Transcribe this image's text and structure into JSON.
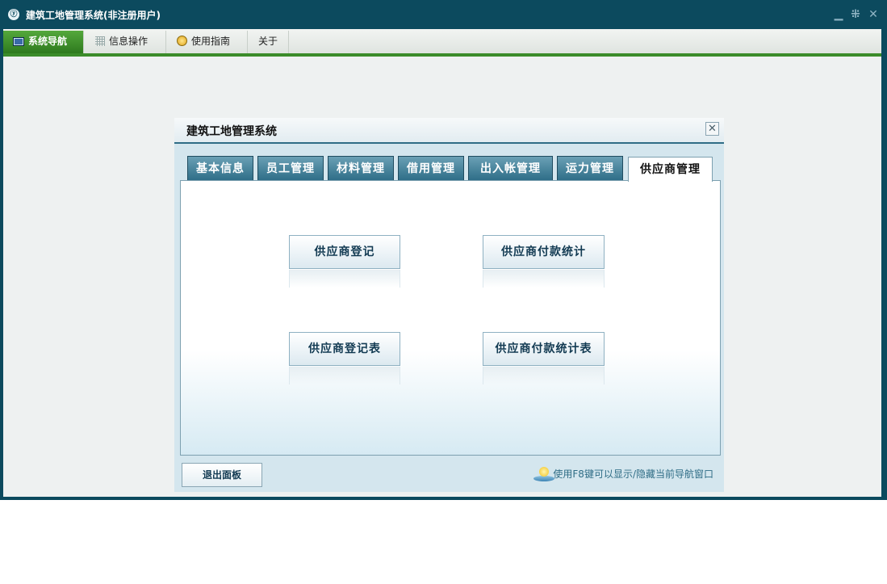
{
  "window": {
    "title": "建筑工地管理系统(非注册用户)",
    "logo_text": "ⓨ",
    "controls": {
      "minimize": "▁",
      "restore": "⁜",
      "close": "✕"
    }
  },
  "menubar": {
    "tabs": [
      {
        "label": "系统导航",
        "icon": "monitor-icon",
        "active": true
      },
      {
        "label": "信息操作",
        "icon": "grid-icon",
        "active": false
      },
      {
        "label": "使用指南",
        "icon": "bulb-icon",
        "active": false
      },
      {
        "label": "关于",
        "icon": "",
        "active": false
      }
    ]
  },
  "panel": {
    "title": "建筑工地管理系统",
    "close_label": "✕",
    "tabs": [
      "基本信息",
      "员工管理",
      "材料管理",
      "借用管理",
      "出入帐管理",
      "运力管理",
      "供应商管理"
    ],
    "active_tab": "供应商管理",
    "buttons": [
      "供应商登记",
      "供应商付款统计",
      "供应商登记表",
      "供应商付款统计表"
    ],
    "exit_label": "退出面板",
    "tip": "使用F8键可以显示/隐藏当前导航窗口"
  },
  "colors": {
    "frame": "#0c4a5e",
    "menu_accent": "#3b8c2a",
    "tab_bg": "#2f6e88",
    "panel_bg": "#d4e6ee"
  }
}
